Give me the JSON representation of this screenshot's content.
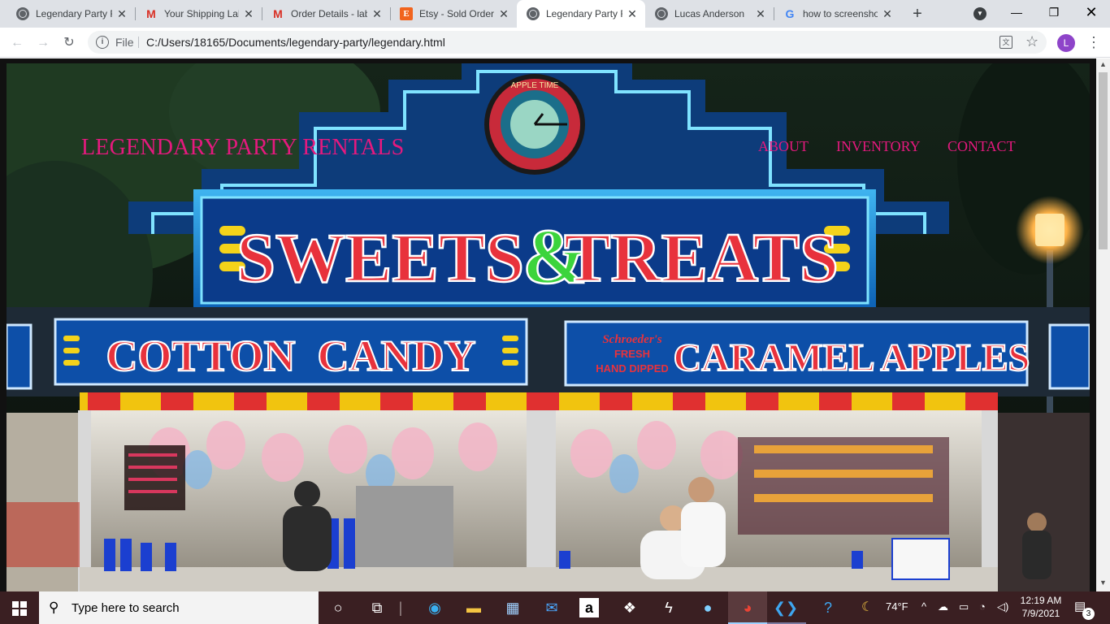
{
  "browser": {
    "tabs": [
      {
        "title": "Legendary Party Rentals",
        "icon": "globe-icon",
        "active": false
      },
      {
        "title": "Your Shipping Label",
        "icon": "gmail-icon",
        "active": false
      },
      {
        "title": "Order Details - lab",
        "icon": "gmail-icon",
        "active": false
      },
      {
        "title": "Etsy - Sold Orders",
        "icon": "etsy-icon",
        "active": false
      },
      {
        "title": "Legendary Party Rentals",
        "icon": "globe-icon",
        "active": true
      },
      {
        "title": "Lucas Anderson",
        "icon": "globe-icon",
        "active": false
      },
      {
        "title": "how to screenshot",
        "icon": "google-icon",
        "active": false
      }
    ],
    "address": {
      "scheme_label": "File",
      "url": "C:/Users/18165/Documents/legendary-party/legendary.html"
    },
    "profile_initial": "L"
  },
  "site": {
    "title": "LEGENDARY PARTY RENTALS",
    "nav": [
      "ABOUT",
      "INVENTORY",
      "CONTACT"
    ],
    "accent_color": "#e5197e",
    "hero": {
      "sign_main_left": "SWEETS",
      "sign_main_amp": "&",
      "sign_main_right": "TREATS",
      "sign_left": "COTTON  CANDY",
      "sign_right": "CARAMEL APPLES",
      "sign_right_script_1": "Schroeder's",
      "sign_right_script_2": "FRESH",
      "sign_right_script_3": "HAND DIPPED",
      "clock_text": "APPLE TIME"
    }
  },
  "taskbar": {
    "search_placeholder": "Type here to search",
    "weather": "74°F",
    "time": "12:19 AM",
    "date": "7/9/2021",
    "notification_count": "3"
  }
}
